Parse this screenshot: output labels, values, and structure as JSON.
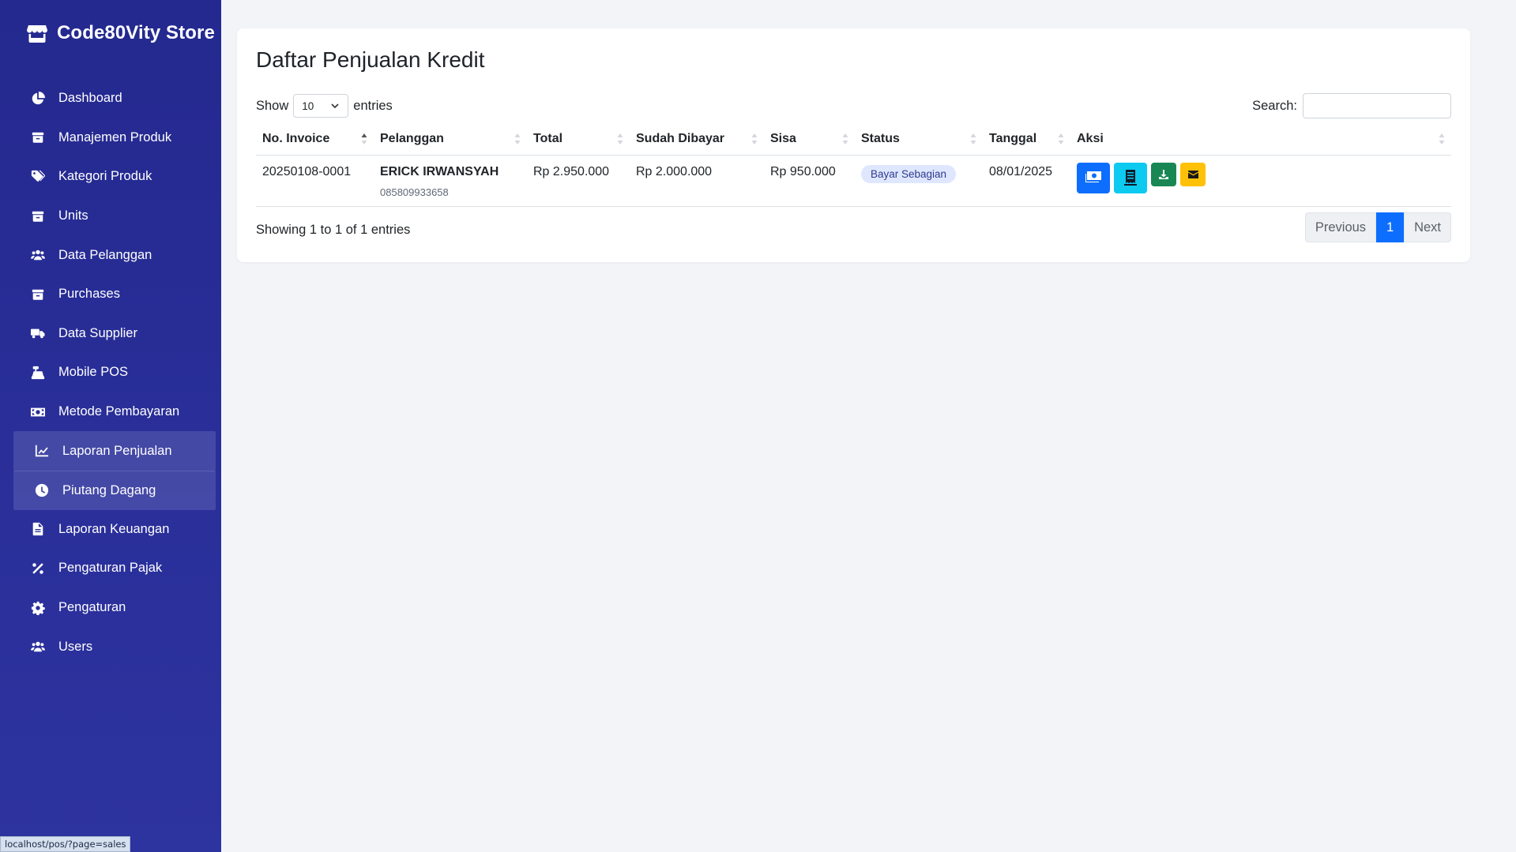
{
  "brand": {
    "title": "Code80Vity Store"
  },
  "sidebar": {
    "items": [
      {
        "label": "Dashboard",
        "icon": "chart-pie-icon"
      },
      {
        "label": "Manajemen Produk",
        "icon": "box-icon"
      },
      {
        "label": "Kategori Produk",
        "icon": "tags-icon"
      },
      {
        "label": "Units",
        "icon": "box-icon"
      },
      {
        "label": "Data Pelanggan",
        "icon": "users-icon"
      },
      {
        "label": "Purchases",
        "icon": "box-icon"
      },
      {
        "label": "Data Supplier",
        "icon": "truck-icon"
      },
      {
        "label": "Mobile POS",
        "icon": "cash-register-icon"
      },
      {
        "label": "Metode Pembayaran",
        "icon": "money-bill-icon"
      },
      {
        "label": "Laporan Penjualan",
        "icon": "line-chart-icon",
        "active": true
      },
      {
        "label": "Piutang Dagang",
        "icon": "clock-icon",
        "active": true
      },
      {
        "label": "Laporan Keuangan",
        "icon": "file-icon"
      },
      {
        "label": "Pengaturan Pajak",
        "icon": "percent-icon"
      },
      {
        "label": "Pengaturan",
        "icon": "gear-icon"
      },
      {
        "label": "Users",
        "icon": "users-icon"
      }
    ]
  },
  "statusbar": {
    "url": "localhost/pos/?page=sales"
  },
  "main": {
    "title": "Daftar Penjualan Kredit",
    "show_label": "Show",
    "entries_value": "10",
    "entries_label": "entries",
    "search_label": "Search:",
    "search_value": "",
    "columns": [
      "No. Invoice",
      "Pelanggan",
      "Total",
      "Sudah Dibayar",
      "Sisa",
      "Status",
      "Tanggal",
      "Aksi"
    ],
    "rows": [
      {
        "invoice": "20250108-0001",
        "customer_name": "ERICK IRWANSYAH",
        "customer_phone": "085809933658",
        "total": "Rp 2.950.000",
        "paid": "Rp 2.000.000",
        "remaining": "Rp 950.000",
        "status": "Bayar Sebagian",
        "date": "08/01/2025"
      }
    ],
    "info": "Showing 1 to 1 of 1 entries",
    "pagination": {
      "previous": "Previous",
      "current": "1",
      "next": "Next"
    }
  },
  "colors": {
    "sidebar": "#24298f",
    "primary": "#0d6efd",
    "info": "#0dcaf0",
    "success": "#198754",
    "warning": "#ffc107",
    "badge_bg": "#dfe7ff"
  }
}
